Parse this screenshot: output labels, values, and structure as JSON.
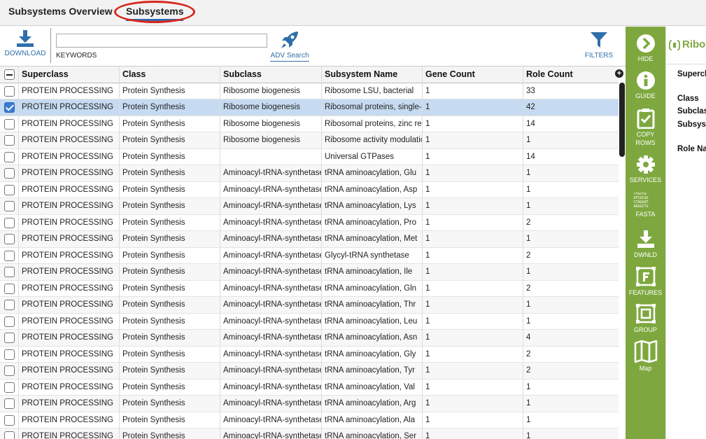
{
  "tabs": [
    {
      "label": "Subsystems Overview"
    },
    {
      "label": "Subsystems"
    }
  ],
  "toolbar": {
    "download_label": "DOWNLOAD",
    "keywords_label": "KEYWORDS",
    "keywords_value": "",
    "adv_search_label": "ADV Search",
    "filters_label": "FILTERS"
  },
  "grid": {
    "columns": [
      "Superclass",
      "Class",
      "Subclass",
      "Subsystem Name",
      "Gene Count",
      "Role Count"
    ],
    "rows": [
      {
        "selected": false,
        "cells": [
          "PROTEIN PROCESSING",
          "Protein Synthesis",
          "Ribosome biogenesis",
          "Ribosome LSU, bacterial",
          "1",
          "33"
        ]
      },
      {
        "selected": true,
        "cells": [
          "PROTEIN PROCESSING",
          "Protein Synthesis",
          "Ribosome biogenesis",
          "Ribosomal proteins, single-co",
          "1",
          "42"
        ]
      },
      {
        "selected": false,
        "cells": [
          "PROTEIN PROCESSING",
          "Protein Synthesis",
          "Ribosome biogenesis",
          "Ribosomal proteins, zinc requ",
          "1",
          "14"
        ]
      },
      {
        "selected": false,
        "cells": [
          "PROTEIN PROCESSING",
          "Protein Synthesis",
          "Ribosome biogenesis",
          "Ribosome activity modulation",
          "1",
          "1"
        ]
      },
      {
        "selected": false,
        "cells": [
          "PROTEIN PROCESSING",
          "Protein Synthesis",
          "",
          "Universal GTPases",
          "1",
          "14"
        ]
      },
      {
        "selected": false,
        "cells": [
          "PROTEIN PROCESSING",
          "Protein Synthesis",
          "Aminoacyl-tRNA-synthetases",
          "tRNA aminoacylation, Glu",
          "1",
          "1"
        ]
      },
      {
        "selected": false,
        "cells": [
          "PROTEIN PROCESSING",
          "Protein Synthesis",
          "Aminoacyl-tRNA-synthetases",
          "tRNA aminoacylation, Asp",
          "1",
          "1"
        ]
      },
      {
        "selected": false,
        "cells": [
          "PROTEIN PROCESSING",
          "Protein Synthesis",
          "Aminoacyl-tRNA-synthetases",
          "tRNA aminoacylation, Lys",
          "1",
          "1"
        ]
      },
      {
        "selected": false,
        "cells": [
          "PROTEIN PROCESSING",
          "Protein Synthesis",
          "Aminoacyl-tRNA-synthetases",
          "tRNA aminoacylation, Pro",
          "1",
          "2"
        ]
      },
      {
        "selected": false,
        "cells": [
          "PROTEIN PROCESSING",
          "Protein Synthesis",
          "Aminoacyl-tRNA-synthetases",
          "tRNA aminoacylation, Met",
          "1",
          "1"
        ]
      },
      {
        "selected": false,
        "cells": [
          "PROTEIN PROCESSING",
          "Protein Synthesis",
          "Aminoacyl-tRNA-synthetases",
          "Glycyl-tRNA synthetase",
          "1",
          "2"
        ]
      },
      {
        "selected": false,
        "cells": [
          "PROTEIN PROCESSING",
          "Protein Synthesis",
          "Aminoacyl-tRNA-synthetases",
          "tRNA aminoacylation, Ile",
          "1",
          "1"
        ]
      },
      {
        "selected": false,
        "cells": [
          "PROTEIN PROCESSING",
          "Protein Synthesis",
          "Aminoacyl-tRNA-synthetases",
          "tRNA aminoacylation, Gln",
          "1",
          "2"
        ]
      },
      {
        "selected": false,
        "cells": [
          "PROTEIN PROCESSING",
          "Protein Synthesis",
          "Aminoacyl-tRNA-synthetases",
          "tRNA aminoacylation, Thr",
          "1",
          "1"
        ]
      },
      {
        "selected": false,
        "cells": [
          "PROTEIN PROCESSING",
          "Protein Synthesis",
          "Aminoacyl-tRNA-synthetases",
          "tRNA aminoacylation, Leu",
          "1",
          "1"
        ]
      },
      {
        "selected": false,
        "cells": [
          "PROTEIN PROCESSING",
          "Protein Synthesis",
          "Aminoacyl-tRNA-synthetases",
          "tRNA aminoacylation, Asn",
          "1",
          "4"
        ]
      },
      {
        "selected": false,
        "cells": [
          "PROTEIN PROCESSING",
          "Protein Synthesis",
          "Aminoacyl-tRNA-synthetases",
          "tRNA aminoacylation, Gly",
          "1",
          "2"
        ]
      },
      {
        "selected": false,
        "cells": [
          "PROTEIN PROCESSING",
          "Protein Synthesis",
          "Aminoacyl-tRNA-synthetases",
          "tRNA aminoacylation, Tyr",
          "1",
          "2"
        ]
      },
      {
        "selected": false,
        "cells": [
          "PROTEIN PROCESSING",
          "Protein Synthesis",
          "Aminoacyl-tRNA-synthetases",
          "tRNA aminoacylation, Val",
          "1",
          "1"
        ]
      },
      {
        "selected": false,
        "cells": [
          "PROTEIN PROCESSING",
          "Protein Synthesis",
          "Aminoacyl-tRNA-synthetases",
          "tRNA aminoacylation, Arg",
          "1",
          "1"
        ]
      },
      {
        "selected": false,
        "cells": [
          "PROTEIN PROCESSING",
          "Protein Synthesis",
          "Aminoacyl-tRNA-synthetases",
          "tRNA aminoacylation, Ala",
          "1",
          "1"
        ]
      },
      {
        "selected": false,
        "cells": [
          "PROTEIN PROCESSING",
          "Protein Synthesis",
          "Aminoacyl-tRNA-synthetases",
          "tRNA aminoacylation, Ser",
          "1",
          "1"
        ]
      }
    ]
  },
  "sidebar": {
    "items": [
      {
        "label": "HIDE",
        "icon": "chevron-right-circle-icon"
      },
      {
        "label": "GUIDE",
        "icon": "info-icon"
      },
      {
        "label": "COPY ROWS",
        "icon": "clipboard-check-icon"
      },
      {
        "label": "SERVICES",
        "icon": "gear-icon"
      },
      {
        "label": "FASTA",
        "icon": "fasta-icon"
      },
      {
        "label": "DWNLD",
        "icon": "download-icon"
      },
      {
        "label": "FEATURES",
        "icon": "features-icon"
      },
      {
        "label": "GROUP",
        "icon": "group-icon"
      },
      {
        "label": "Map",
        "icon": "map-icon"
      }
    ],
    "fasta_text": [
      ">fasta",
      "ATCGCGG",
      "CTAGGAT",
      "AAGGCTG"
    ]
  },
  "detail": {
    "title": "Ribos",
    "labels": [
      "Supercla",
      "Class",
      "Subclas",
      "Subsyst",
      "Role Na"
    ]
  },
  "colors": {
    "accent_green": "#7ea83f",
    "link_blue": "#2f6fa9",
    "selected_row": "#c6dbf1",
    "highlight_circle": "#d7261e"
  }
}
